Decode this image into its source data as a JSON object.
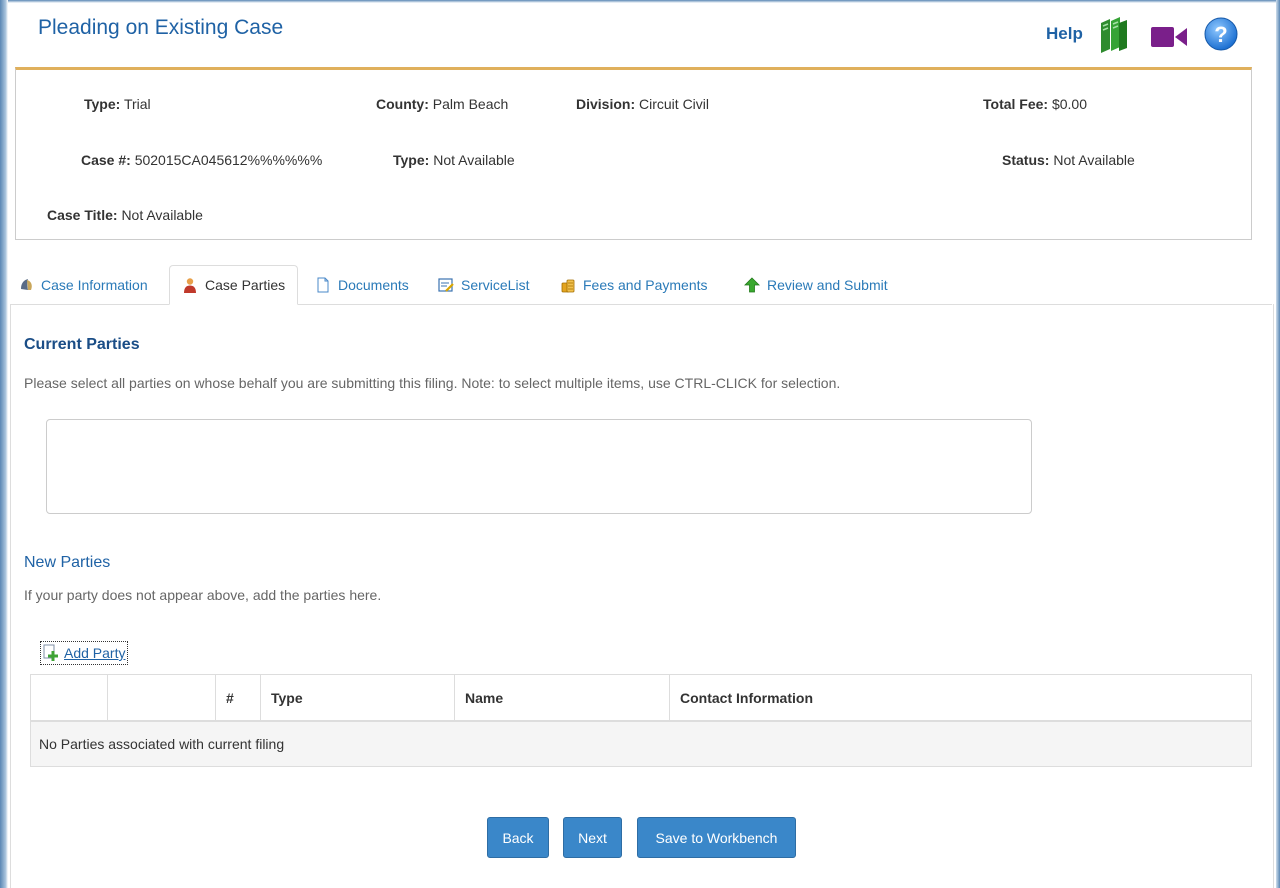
{
  "page": {
    "title": "Pleading on Existing Case"
  },
  "help": {
    "label": "Help"
  },
  "case_header": {
    "type_label": "Type:",
    "type_value": "Trial",
    "county_label": "County:",
    "county_value": "Palm Beach",
    "division_label": "Division:",
    "division_value": "Circuit Civil",
    "total_fee_label": "Total Fee:",
    "total_fee_value": "$0.00",
    "case_no_label": "Case #:",
    "case_no_value": "502015CA045612%%%%%%",
    "case_type_label": "Type:",
    "case_type_value": "Not Available",
    "status_label": "Status:",
    "status_value": "Not Available",
    "case_title_label": "Case Title:",
    "case_title_value": "Not Available"
  },
  "tabs": [
    {
      "label": "Case Information",
      "icon": "case-info-icon"
    },
    {
      "label": "Case Parties",
      "icon": "person-icon",
      "active": true
    },
    {
      "label": "Documents",
      "icon": "document-icon"
    },
    {
      "label": "ServiceList",
      "icon": "service-list-icon"
    },
    {
      "label": "Fees and Payments",
      "icon": "coins-icon"
    },
    {
      "label": "Review and Submit",
      "icon": "green-up-arrow-icon"
    }
  ],
  "current_parties": {
    "title": "Current Parties",
    "hint": "Please select all parties on whose behalf you are submitting this filing. Note: to select multiple items, use CTRL-CLICK for selection."
  },
  "new_parties": {
    "title": "New Parties",
    "hint": "If your party does not appear above, add the parties here.",
    "add_label": "Add Party"
  },
  "table": {
    "headers": [
      "",
      "",
      "#",
      "Type",
      "Name",
      "Contact Information"
    ],
    "empty_message": "No Parties associated with current filing"
  },
  "buttons": {
    "back": "Back",
    "next": "Next",
    "save": "Save to Workbench"
  },
  "colors": {
    "link": "#2a7ab8",
    "title": "#1f62a5",
    "button": "#3a87c9",
    "accent_border": "#e0b05c"
  }
}
